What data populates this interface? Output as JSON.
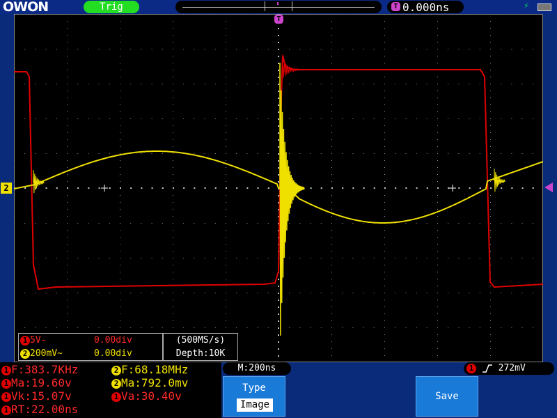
{
  "brand": {
    "logo_text": "OWON"
  },
  "topbar": {
    "trigger_status": "Trig",
    "trigger_delay": "0.000ns",
    "trigger_pos_icon": "T",
    "usb_icon": "usb-icon",
    "battery_icon": "battery-icon"
  },
  "screen": {
    "ch2_marker": "2",
    "ch1": {
      "number": "1",
      "scale": "5V-",
      "offset": "0.00div",
      "color": "#e00000"
    },
    "ch2": {
      "number": "2",
      "scale": "200mV~",
      "offset": "0.00div",
      "color": "#f0e000"
    },
    "sample_rate": "(500MS/s)",
    "depth": "Depth:10K"
  },
  "measurements": [
    {
      "ch": "1",
      "text": "F:383.7KHz"
    },
    {
      "ch": "1",
      "text": "Ma:19.60v"
    },
    {
      "ch": "1",
      "text": "Vk:15.07v"
    },
    {
      "ch": "1",
      "text": "RT:22.00ns"
    },
    {
      "ch": "2",
      "text": "F:68.18MHz"
    },
    {
      "ch": "2",
      "text": "Ma:792.0mv"
    },
    {
      "ch": "1",
      "text": "Va:30.40v"
    }
  ],
  "bottom": {
    "timebase": "M:200ns",
    "trigger_source": "1",
    "trigger_level": "272mV",
    "menu": {
      "type_label": "Type",
      "type_value": "Image",
      "save_label": "Save"
    }
  },
  "colors": {
    "background": "#0a2a7a",
    "trig_ok": "#22dd22",
    "ch1": "#e00000",
    "ch2": "#f0e000",
    "trigger": "#cc44cc",
    "menu_button": "#1a7ad8"
  }
}
